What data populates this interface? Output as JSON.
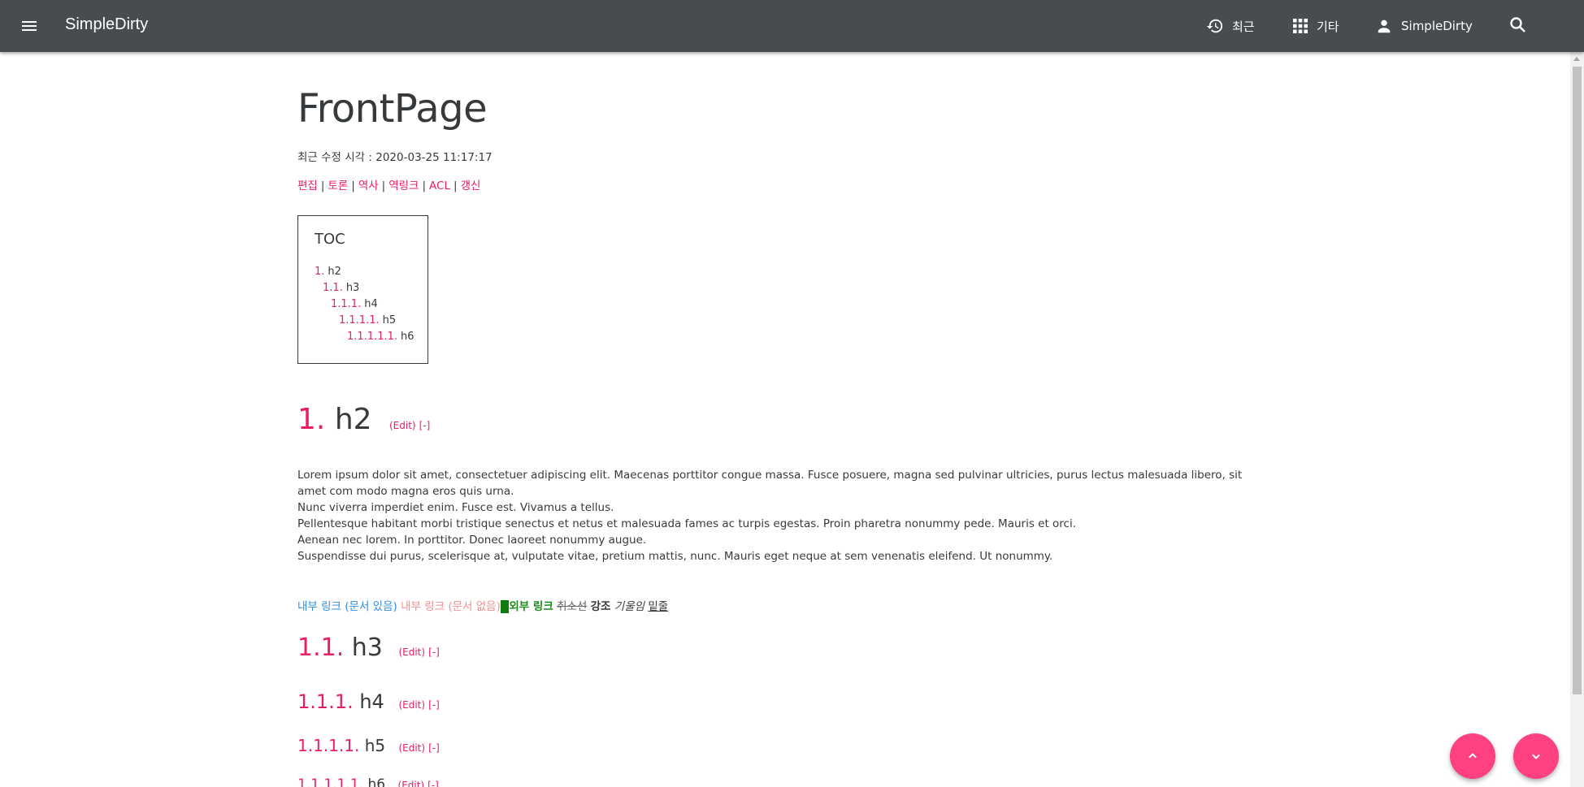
{
  "appbar": {
    "brand": "SimpleDirty",
    "nav": {
      "recent": "최근",
      "other": "기타",
      "user": "SimpleDirty"
    },
    "icons": {
      "menu": "menu-icon",
      "recent": "history-icon",
      "other": "apps-grid-icon",
      "user": "person-icon",
      "search": "search-icon"
    }
  },
  "page": {
    "title": "FrontPage",
    "modified_label": "최근 수정 시각 :",
    "modified_value": "2020-03-25 11:17:17",
    "actions": [
      "편집",
      "토론",
      "역사",
      "역링크",
      "ACL",
      "갱신"
    ],
    "action_separator": "|"
  },
  "toc": {
    "title": "TOC",
    "items": [
      {
        "num": "1.",
        "label": "h2"
      },
      {
        "num": "1.1.",
        "label": "h3"
      },
      {
        "num": "1.1.1.",
        "label": "h4"
      },
      {
        "num": "1.1.1.1.",
        "label": "h5"
      },
      {
        "num": "1.1.1.1.1.",
        "label": "h6"
      }
    ]
  },
  "sections": {
    "edit_label": "(Edit)",
    "fold_label": "[-]",
    "h2": {
      "num": "1.",
      "title": "h2"
    },
    "h3": {
      "num": "1.1.",
      "title": "h3"
    },
    "h4": {
      "num": "1.1.1.",
      "title": "h4"
    },
    "h5": {
      "num": "1.1.1.1.",
      "title": "h5"
    },
    "h6": {
      "num": "1.1.1.1.1.",
      "title": "h6"
    }
  },
  "paragraph": [
    "Lorem ipsum dolor sit amet, consectetuer adipiscing elit. Maecenas porttitor congue massa. Fusce posuere, magna sed pulvinar ultricies, purus lectus malesuada libero, sit amet com modo magna eros quis urna.",
    "Nunc viverra imperdiet enim. Fusce est. Vivamus a tellus.",
    "Pellentesque habitant morbi tristique senectus et netus et malesuada fames ac turpis egestas. Proin pharetra nonummy pede. Mauris et orci.",
    "Aenean nec lorem. In porttitor. Donec laoreet nonummy augue.",
    "Suspendisse dui purus, scelerisque at, vulputate vitae, pretium mattis, nunc. Mauris eget neque at sem venenatis eleifend. Ut nonummy."
  ],
  "formatting": {
    "internal_exists": "내부 링크 (문서 있음)",
    "internal_missing": "내부 링크 (문서 없음)",
    "external_mark": "E",
    "external": "외부 링크",
    "strike": "취소선",
    "bold": "강조",
    "italic": "기울임",
    "underline": "밑줄"
  },
  "colors": {
    "appbar": "#474c50",
    "accent": "#e91e63",
    "fab": "#ff4081",
    "link_exists": "#2f8de4",
    "link_missing": "#f38f8f",
    "link_external": "#1c8b1c"
  }
}
